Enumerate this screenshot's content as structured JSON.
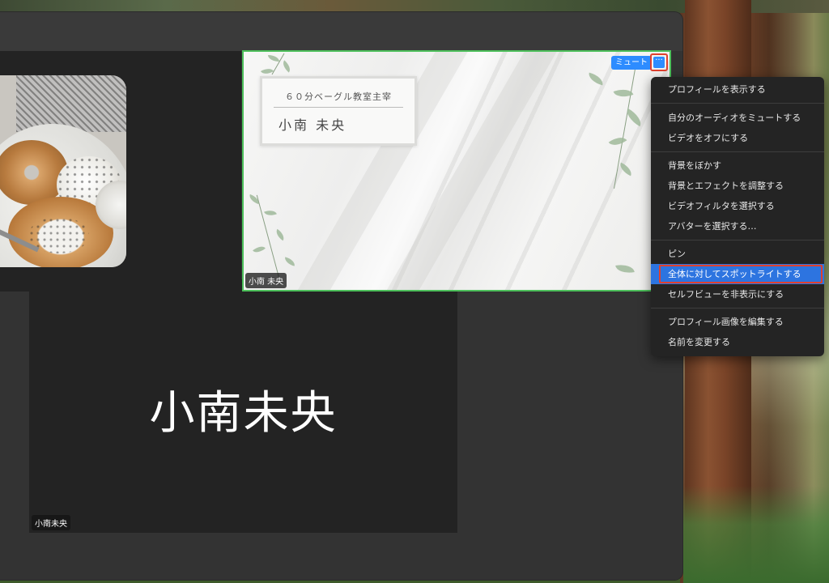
{
  "meeting": {
    "left_tile": {
      "image": "bagel-photo"
    },
    "name_tile": {
      "big_name": "小南未央",
      "name_tag": "小南未央"
    },
    "video_tile": {
      "name_tag": "小南 未央",
      "card_subtitle": "６０分ベーグル教室主宰",
      "card_name": "小南 未央",
      "mute_label": "ミュート",
      "more_label": "···",
      "border_color": "#4dc05b"
    }
  },
  "context_menu": {
    "items": [
      {
        "label": "プロフィールを表示する"
      },
      {
        "label": "自分のオーディオをミュートする"
      },
      {
        "label": "ビデオをオフにする"
      },
      {
        "label": "背景をぼかす"
      },
      {
        "label": "背景とエフェクトを調整する"
      },
      {
        "label": "ビデオフィルタを選択する"
      },
      {
        "label": "アバターを選択する…"
      },
      {
        "label": "ピン"
      },
      {
        "label": "全体に対してスポットライトする",
        "selected": true
      },
      {
        "label": "セルフビューを非表示にする"
      },
      {
        "label": "プロフィール画像を編集する"
      },
      {
        "label": "名前を変更する"
      }
    ]
  },
  "colors": {
    "accent": "#2d8cff",
    "highlight": "#e0412f",
    "selected_bg": "#2d74e0"
  }
}
